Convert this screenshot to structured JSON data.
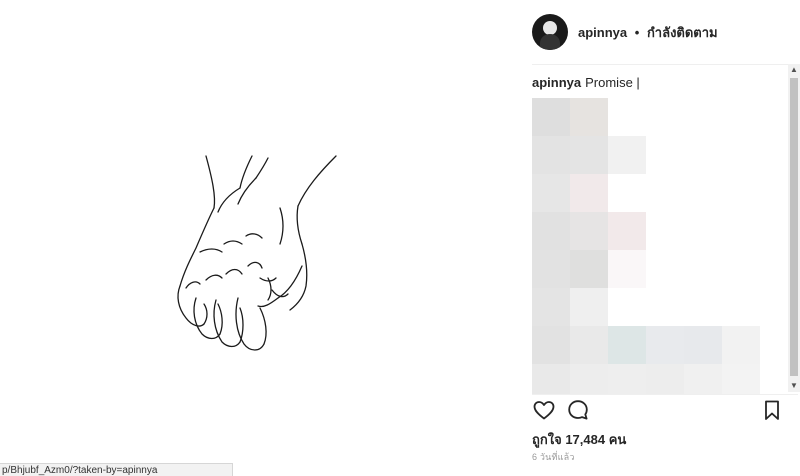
{
  "post": {
    "username": "apinnya",
    "separator": "•",
    "follow_status": "กำลังติดตาม",
    "caption_user": "apinnya",
    "caption_text": "Promise |",
    "likes_text": "ถูกใจ 17,484 คน",
    "time_ago": "6 วันที่แล้ว"
  },
  "icons": {
    "like": "heart-icon",
    "comment": "comment-icon",
    "save": "bookmark-icon",
    "avatar": "avatar",
    "scroll_up": "scroll-up-arrow",
    "scroll_down": "scroll-down-arrow"
  },
  "status_bar": {
    "url": "p/Bhjubf_Azm0/?taken-by=apinnya"
  },
  "colors": {
    "text": "#262626",
    "muted": "#999999",
    "divider": "#efefef"
  }
}
